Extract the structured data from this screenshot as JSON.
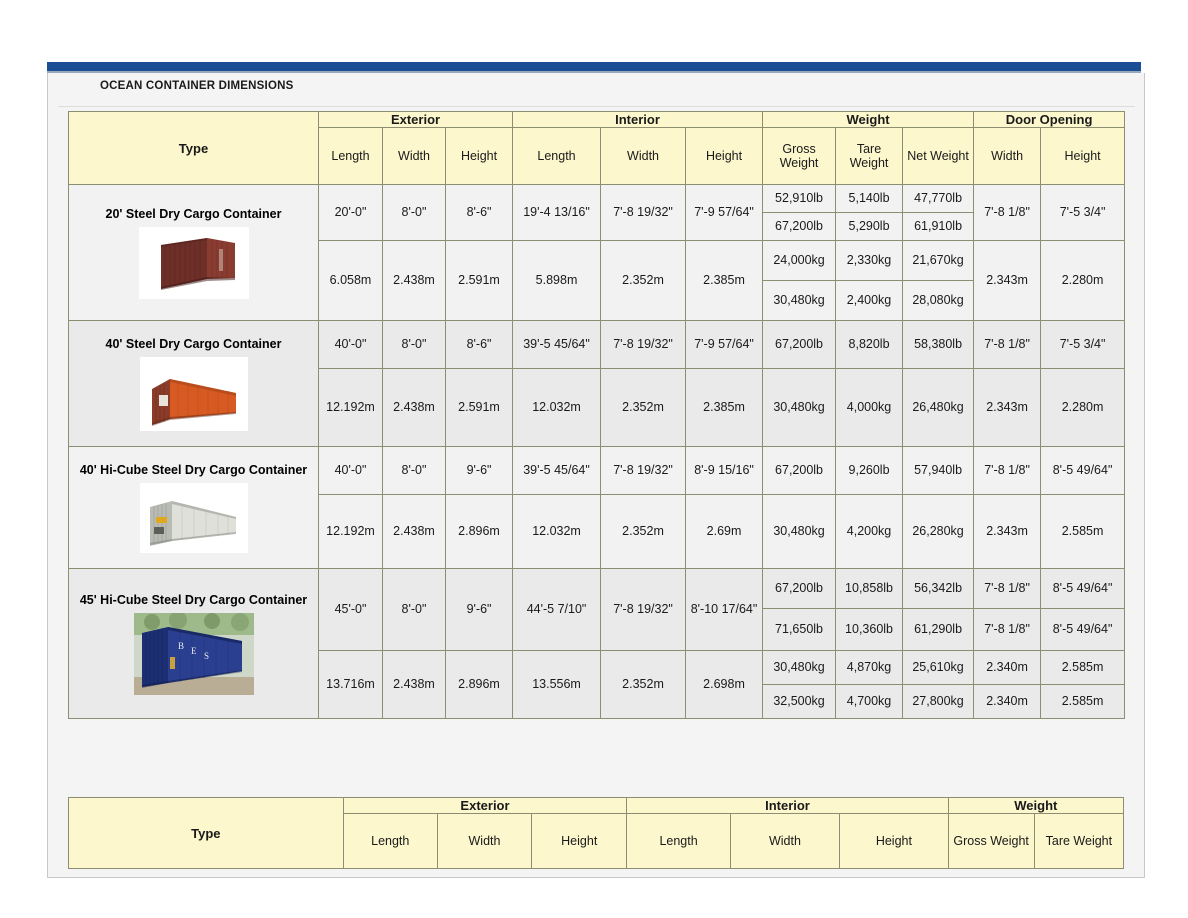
{
  "panel": {
    "title": "OCEAN CONTAINER DIMENSIONS",
    "accent_color": "#1a4f96",
    "header_bg": "#fcf7cd",
    "row_bg": "#f2f2f2",
    "row_bg_alt": "#eaeaea"
  },
  "table": {
    "group_headers": {
      "type": "Type",
      "exterior": "Exterior",
      "interior": "Interior",
      "weight": "Weight",
      "door_opening": "Door Opening"
    },
    "sub_headers": {
      "ext_length": "Length",
      "ext_width": "Width",
      "ext_height": "Height",
      "int_length": "Length",
      "int_width": "Width",
      "int_height": "Height",
      "gross_weight": "Gross Weight",
      "tare_weight": "Tare Weight",
      "net_weight": "Net Weight",
      "door_width": "Width",
      "door_height": "Height"
    },
    "rows": [
      {
        "name": "20' Steel Dry Cargo Container",
        "image": "container-photo-20ft-maroon",
        "imperial": {
          "ext_length": "20'-0\"",
          "ext_width": "8'-0\"",
          "ext_height": "8'-6\"",
          "int_length": "19'-4 13/16\"",
          "int_width": "7'-8 19/32\"",
          "int_height": "7'-9 57/64\"",
          "weights": [
            {
              "gross": "52,910lb",
              "tare": "5,140lb",
              "net": "47,770lb"
            },
            {
              "gross": "67,200lb",
              "tare": "5,290lb",
              "net": "61,910lb"
            }
          ],
          "door_width": "7'-8 1/8\"",
          "door_height": "7'-5 3/4\""
        },
        "metric": {
          "ext_length": "6.058m",
          "ext_width": "2.438m",
          "ext_height": "2.591m",
          "int_length": "5.898m",
          "int_width": "2.352m",
          "int_height": "2.385m",
          "weights": [
            {
              "gross": "24,000kg",
              "tare": "2,330kg",
              "net": "21,670kg"
            },
            {
              "gross": "30,480kg",
              "tare": "2,400kg",
              "net": "28,080kg"
            }
          ],
          "door_width": "2.343m",
          "door_height": "2.280m"
        }
      },
      {
        "name": "40' Steel Dry Cargo Container",
        "image": "container-photo-40ft-orange",
        "imperial": {
          "ext_length": "40'-0\"",
          "ext_width": "8'-0\"",
          "ext_height": "8'-6\"",
          "int_length": "39'-5 45/64\"",
          "int_width": "7'-8 19/32\"",
          "int_height": "7'-9 57/64\"",
          "weights": [
            {
              "gross": "67,200lb",
              "tare": "8,820lb",
              "net": "58,380lb"
            }
          ],
          "door_width": "7'-8 1/8\"",
          "door_height": "7'-5 3/4\""
        },
        "metric": {
          "ext_length": "12.192m",
          "ext_width": "2.438m",
          "ext_height": "2.591m",
          "int_length": "12.032m",
          "int_width": "2.352m",
          "int_height": "2.385m",
          "weights": [
            {
              "gross": "30,480kg",
              "tare": "4,000kg",
              "net": "26,480kg"
            }
          ],
          "door_width": "2.343m",
          "door_height": "2.280m"
        }
      },
      {
        "name": "40' Hi-Cube Steel Dry Cargo Container",
        "image": "container-photo-40ft-hicube-white",
        "imperial": {
          "ext_length": "40'-0\"",
          "ext_width": "8'-0\"",
          "ext_height": "9'-6\"",
          "int_length": "39'-5 45/64\"",
          "int_width": "7'-8 19/32\"",
          "int_height": "8'-9 15/16\"",
          "weights": [
            {
              "gross": "67,200lb",
              "tare": "9,260lb",
              "net": "57,940lb"
            }
          ],
          "door_width": "7'-8 1/8\"",
          "door_height": "8'-5 49/64\""
        },
        "metric": {
          "ext_length": "12.192m",
          "ext_width": "2.438m",
          "ext_height": "2.896m",
          "int_length": "12.032m",
          "int_width": "2.352m",
          "int_height": "2.69m",
          "weights": [
            {
              "gross": "30,480kg",
              "tare": "4,200kg",
              "net": "26,280kg"
            }
          ],
          "door_width": "2.343m",
          "door_height": "2.585m"
        }
      },
      {
        "name": "45' Hi-Cube Steel Dry Cargo Container",
        "image": "container-photo-45ft-hicube-blue",
        "imperial": {
          "ext_length": "45'-0\"",
          "ext_width": "8'-0\"",
          "ext_height": "9'-6\"",
          "int_length": "44'-5 7/10\"",
          "int_width": "7'-8 19/32\"",
          "int_height": "8'-10 17/64\"",
          "weights": [
            {
              "gross": "67,200lb",
              "tare": "10,858lb",
              "net": "56,342lb",
              "door_width": "7'-8 1/8\"",
              "door_height": "8'-5 49/64\""
            },
            {
              "gross": "71,650lb",
              "tare": "10,360lb",
              "net": "61,290lb",
              "door_width": "7'-8 1/8\"",
              "door_height": "8'-5 49/64\""
            }
          ]
        },
        "metric": {
          "ext_length": "13.716m",
          "ext_width": "2.438m",
          "ext_height": "2.896m",
          "int_length": "13.556m",
          "int_width": "2.352m",
          "int_height": "2.698m",
          "weights": [
            {
              "gross": "30,480kg",
              "tare": "4,870kg",
              "net": "25,610kg",
              "door_width": "2.340m",
              "door_height": "2.585m"
            },
            {
              "gross": "32,500kg",
              "tare": "4,700kg",
              "net": "27,800kg",
              "door_width": "2.340m",
              "door_height": "2.585m"
            }
          ]
        }
      }
    ]
  },
  "bottom_table": {
    "group_headers": {
      "type": "Type",
      "exterior": "Exterior",
      "interior": "Interior",
      "weight": "Weight"
    },
    "sub_headers": {
      "ext_length": "Length",
      "ext_width": "Width",
      "ext_height": "Height",
      "int_length": "Length",
      "int_width": "Width",
      "int_height": "Height",
      "gross_weight": "Gross Weight",
      "tare_weight": "Tare Weight"
    }
  }
}
